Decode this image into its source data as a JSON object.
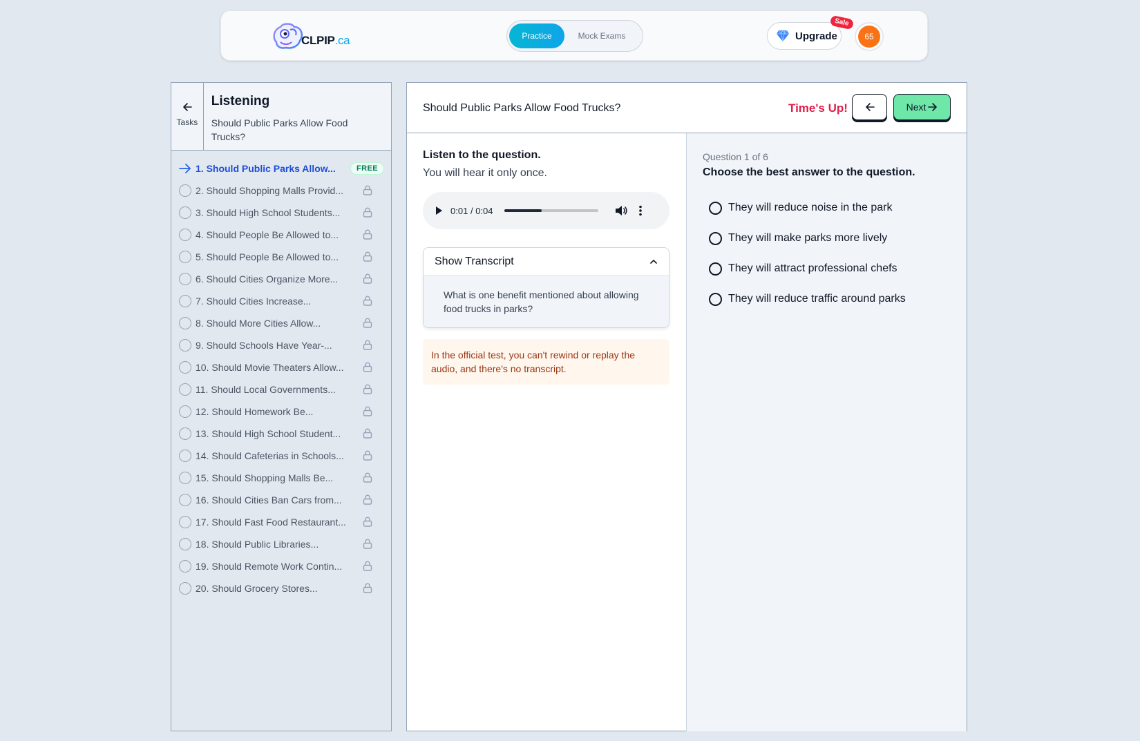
{
  "header": {
    "logo_text": "CLPIP",
    "logo_suffix": ".ca",
    "tabs": [
      {
        "label": "Practice",
        "active": true
      },
      {
        "label": "Mock Exams",
        "active": false
      }
    ],
    "upgrade_label": "Upgrade",
    "sale_badge": "Sale",
    "avatar_text": "65",
    "accent_color": "#0ea5e9"
  },
  "sidebar": {
    "back_label": "Tasks",
    "section_title": "Listening",
    "section_subtitle": "Should Public Parks Allow Food Trucks?",
    "free_badge": "FREE",
    "items": [
      {
        "label": "1. Should Public Parks Allow...",
        "current": true
      },
      {
        "label": "2. Should Shopping Malls Provid...",
        "locked": true
      },
      {
        "label": "3. Should High School Students...",
        "locked": true
      },
      {
        "label": "4. Should People Be Allowed to...",
        "locked": true
      },
      {
        "label": "5. Should People Be Allowed to...",
        "locked": true
      },
      {
        "label": "6. Should Cities Organize More...",
        "locked": true
      },
      {
        "label": "7. Should Cities Increase...",
        "locked": true
      },
      {
        "label": "8. Should More Cities Allow...",
        "locked": true
      },
      {
        "label": "9. Should Schools Have Year-...",
        "locked": true
      },
      {
        "label": "10. Should Movie Theaters Allow...",
        "locked": true
      },
      {
        "label": "11. Should Local Governments...",
        "locked": true
      },
      {
        "label": "12. Should Homework Be...",
        "locked": true
      },
      {
        "label": "13. Should High School Student...",
        "locked": true
      },
      {
        "label": "14. Should Cafeterias in Schools...",
        "locked": true
      },
      {
        "label": "15. Should Shopping Malls Be...",
        "locked": true
      },
      {
        "label": "16. Should Cities Ban Cars from...",
        "locked": true
      },
      {
        "label": "17. Should Fast Food Restaurant...",
        "locked": true
      },
      {
        "label": "18. Should Public Libraries...",
        "locked": true
      },
      {
        "label": "19. Should Remote Work Contin...",
        "locked": true
      },
      {
        "label": "20. Should Grocery Stores...",
        "locked": true
      }
    ]
  },
  "main": {
    "title": "Should Public Parks Allow Food Trucks?",
    "times_up": "Time's Up!",
    "next_label": "Next",
    "instructions_title": "Listen to the question.",
    "instructions_sub": "You will hear it only once.",
    "audio": {
      "current": "0:01",
      "separator": "/",
      "duration": "0:04",
      "progress": 0.4
    },
    "transcript_label": "Show Transcript",
    "transcript_text": "What is one benefit mentioned about allowing food trucks in parks?",
    "note": "In the official test, you can't rewind or replay the audio, and there's no transcript.",
    "question_number": "Question 1 of 6",
    "question_text": "Choose the best answer to the question.",
    "options": [
      "They will reduce noise in the park",
      "They will make parks more lively",
      "They will attract professional chefs",
      "They will reduce traffic around parks"
    ]
  }
}
